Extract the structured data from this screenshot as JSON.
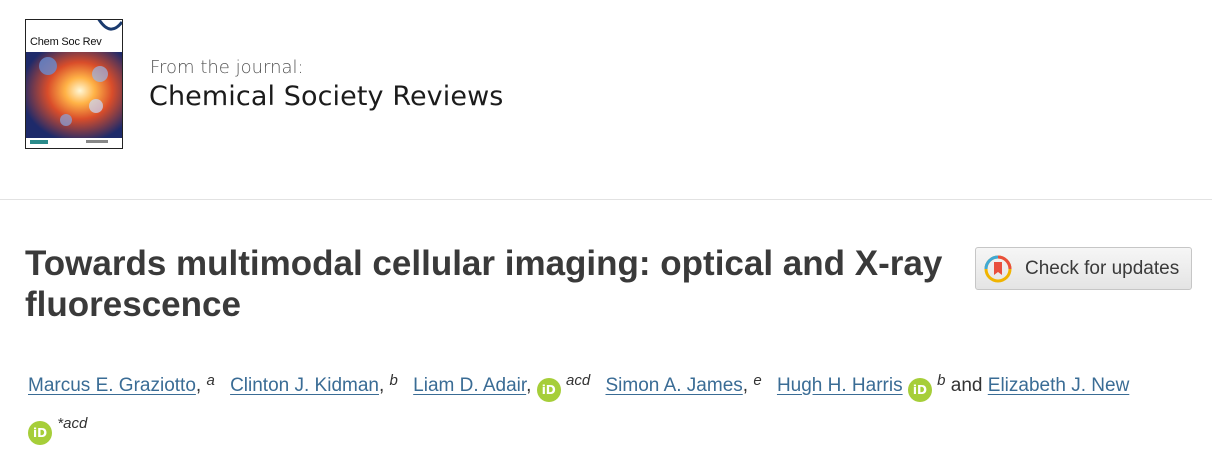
{
  "journal": {
    "cover_title": "Chem Soc Rev",
    "from_label": "From the journal:",
    "name": "Chemical Society Reviews"
  },
  "article": {
    "title": "Towards multimodal cellular imaging: optical and X-ray fluorescence"
  },
  "check_updates": {
    "label": "Check for updates",
    "icon": "crossmark-icon"
  },
  "authors": {
    "items": [
      {
        "name": "Marcus E. Graziotto",
        "sep": ",",
        "aff": "a"
      },
      {
        "name": "Clinton J. Kidman",
        "sep": ",",
        "aff": "b"
      },
      {
        "name": "Liam D. Adair",
        "sep": ",",
        "aff": "acd",
        "orcid": "iD"
      },
      {
        "name": "Simon A. James",
        "sep": ",",
        "aff": "e"
      },
      {
        "name": "Hugh H. Harris",
        "aff": "b",
        "orcid": "iD"
      },
      {
        "name": "Elizabeth J. New",
        "aff": "*acd",
        "orcid": "iD"
      }
    ],
    "conjunction": "and"
  },
  "colors": {
    "link": "#3a6c95",
    "orcid": "#a6ce39",
    "title": "#3a3a3a"
  }
}
